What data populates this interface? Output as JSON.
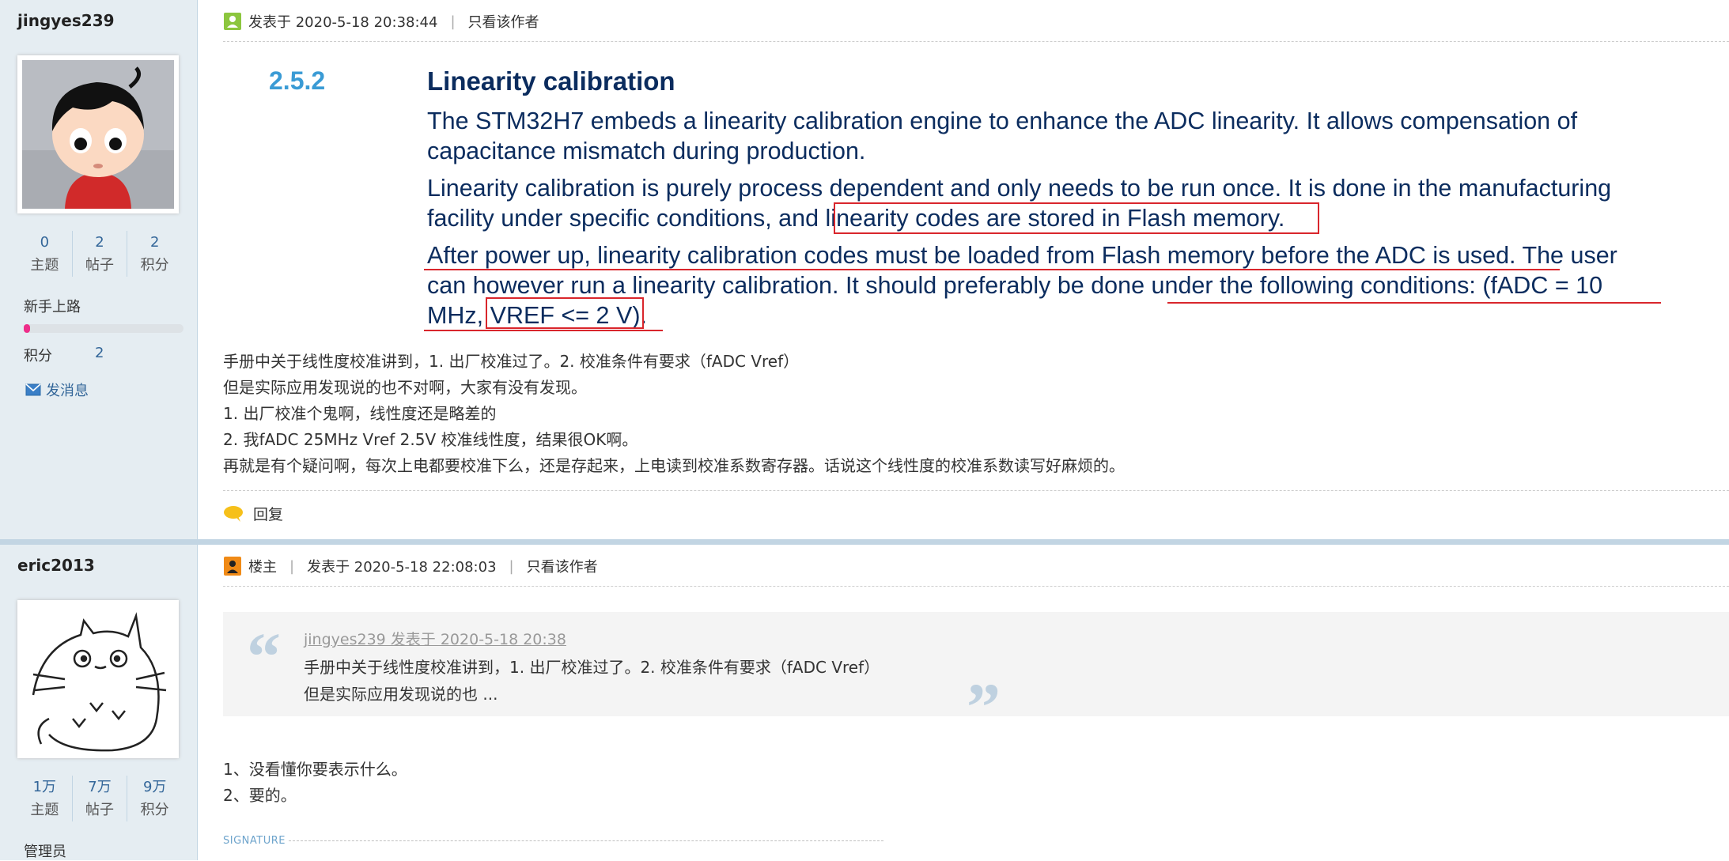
{
  "post1": {
    "user": {
      "name": "jingyes239",
      "stats": [
        {
          "value": "0",
          "label": "主题"
        },
        {
          "value": "2",
          "label": "帖子"
        },
        {
          "value": "2",
          "label": "积分"
        }
      ],
      "level": "新手上路",
      "level_progress": 0.04,
      "points_label": "积分",
      "points_value": "2",
      "send_message": "发消息"
    },
    "header": {
      "posted": "发表于 2020-5-18 20:38:44",
      "only_author": "只看该作者"
    },
    "doc": {
      "section_number": "2.5.2",
      "section_title": "Linearity calibration",
      "p1_l1": "The STM32H7 embeds a linearity calibration engine to enhance the ADC linearity. It allows compensation of",
      "p1_l2": "capacitance mismatch during production.",
      "p2_l1": "Linearity calibration is purely process dependent and only needs to be run once. It is done in the manufacturing",
      "p2_l2": "facility under specific conditions, and linearity codes are stored in Flash memory.",
      "p3_l1": "After power up, linearity calibration codes must be loaded from Flash memory before the ADC is used. The user",
      "p3_l2": "can however run a linearity calibration. It should preferably be done under the following conditions: (fADC = 10",
      "p3_l3": "MHz, VREF <= 2 V)."
    },
    "body": [
      "手册中关于线性度校准讲到，1. 出厂校准过了。2. 校准条件有要求（fADC  Vref）",
      "但是实际应用发现说的也不对啊，大家有没有发现。",
      "1. 出厂校准个鬼啊，线性度还是略差的",
      "2. 我fADC 25MHz  Vref 2.5V 校准线性度，结果很OK啊。",
      "再就是有个疑问啊，每次上电都要校准下么，还是存起来，上电读到校准系数寄存器。话说这个线性度的校准系数读写好麻烦的。"
    ],
    "reply_label": "回复"
  },
  "post2": {
    "user": {
      "name": "eric2013",
      "stats": [
        {
          "value": "1万",
          "label": "主题"
        },
        {
          "value": "7万",
          "label": "帖子"
        },
        {
          "value": "9万",
          "label": "积分"
        }
      ],
      "role": "管理员"
    },
    "header": {
      "owner_badge": "楼主",
      "posted": "发表于 2020-5-18 22:08:03",
      "only_author": "只看该作者"
    },
    "quote": {
      "open_mark": "“",
      "close_mark": "”",
      "author": "jingyes239 发表于 2020-5-18 20:38",
      "line1": "手册中关于线性度校准讲到，1. 出厂校准过了。2. 校准条件有要求（fADC  Vref）",
      "line2": "但是实际应用发现说的也 ..."
    },
    "body": [
      "1、没看懂你要表示什么。",
      "2、要的。"
    ],
    "signature_label": "SIGNATURE"
  },
  "colors": {
    "sidebar_bg": "#e5edf2",
    "link": "#336699",
    "doc_text": "#0b2c5e",
    "doc_section": "#3a9bd5",
    "highlight_red": "#d9262c",
    "progress": "#ee2e8a"
  }
}
